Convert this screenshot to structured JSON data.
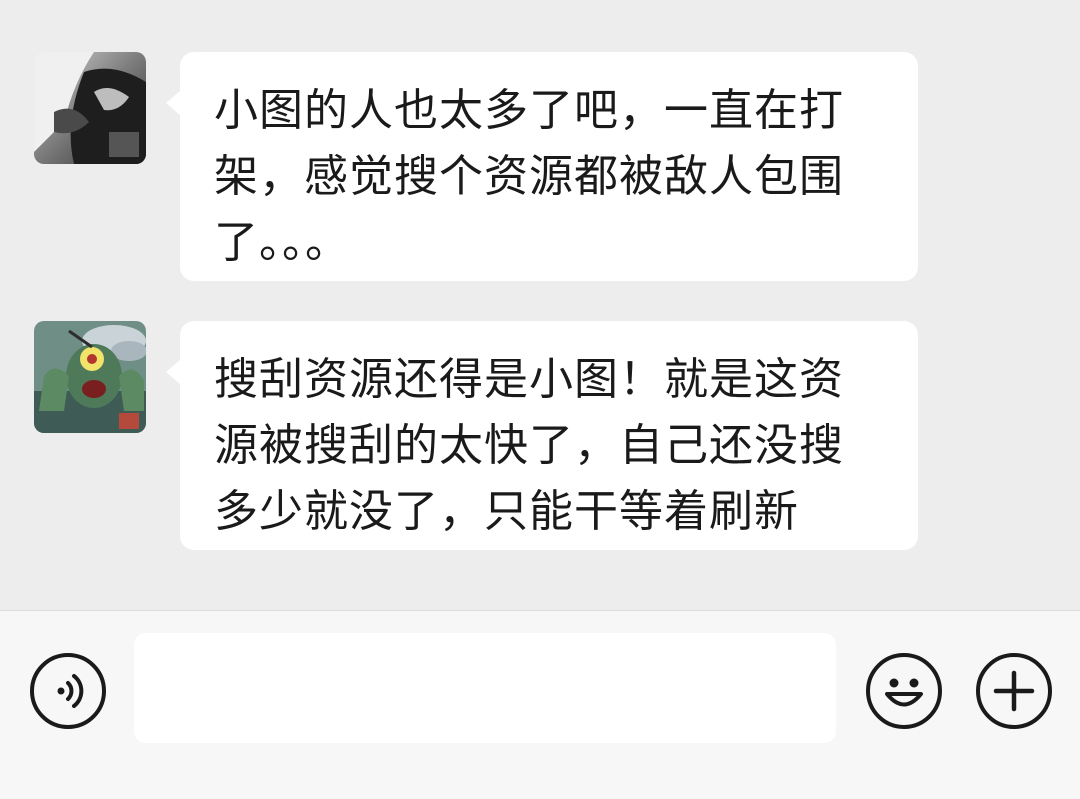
{
  "messages": [
    {
      "sender": "user-1",
      "text": "小图的人也太多了吧，一直在打架，感觉搜个资源都被敌人包围了。。。"
    },
    {
      "sender": "user-2",
      "text": "搜刮资源还得是小图！就是这资源被搜刮的太快了，自己还没搜多少就没了，只能干等着刷新"
    }
  ],
  "input_bar": {
    "placeholder": "",
    "voice_icon": "voice-icon",
    "emoji_icon": "emoji-icon",
    "plus_icon": "plus-icon"
  },
  "colors": {
    "background": "#ededed",
    "bubble": "#ffffff",
    "text": "#1a1a1a",
    "input_bar": "#f7f7f7"
  }
}
